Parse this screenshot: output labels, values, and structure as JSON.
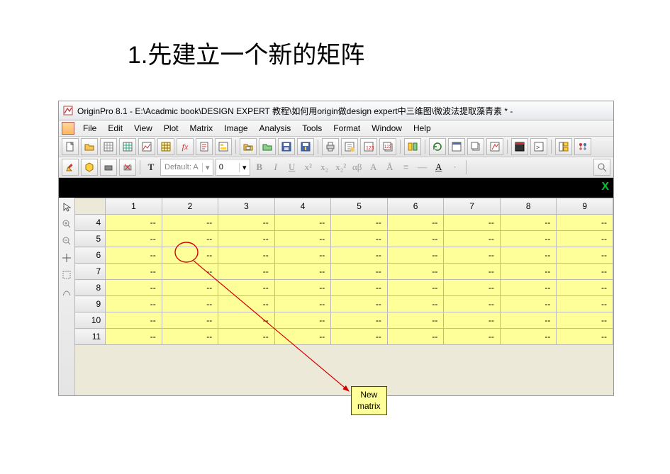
{
  "page_title_prefix": "1.",
  "page_title_text": "先建立一个新的矩阵",
  "titlebar": {
    "text": "OriginPro 8.1 - E:\\Acadmic book\\DESIGN EXPERT 教程\\如何用origin做design expert中三维图\\微波法提取藻青素 * -"
  },
  "menu": {
    "items": [
      "File",
      "Edit",
      "View",
      "Plot",
      "Matrix",
      "Image",
      "Analysis",
      "Tools",
      "Format",
      "Window",
      "Help"
    ]
  },
  "format_toolbar": {
    "font_prefix": "Default: A",
    "size_value": "0",
    "buttons": [
      "B",
      "I",
      "U",
      "x²",
      "x₂",
      "x₂²",
      "αβ",
      "A",
      "Å",
      "≡",
      "—",
      "A",
      "·"
    ]
  },
  "darkband": {
    "x": "X"
  },
  "matrix": {
    "col_headers": [
      "1",
      "2",
      "3",
      "4",
      "5",
      "6",
      "7",
      "8",
      "9"
    ],
    "row_headers": [
      "4",
      "5",
      "6",
      "7",
      "8",
      "9",
      "10",
      "11"
    ],
    "cell_value": "--"
  },
  "callout": {
    "line1": "New",
    "line2": "matrix"
  }
}
